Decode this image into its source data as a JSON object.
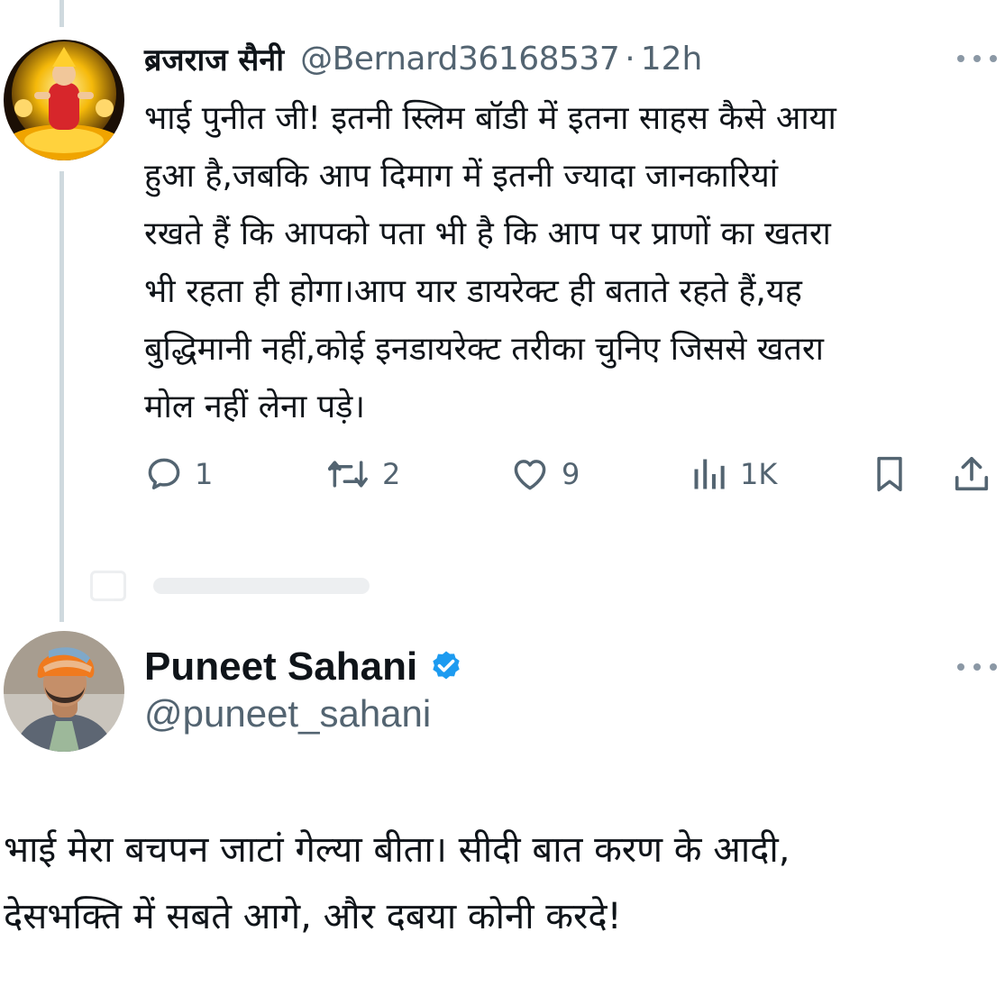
{
  "reply": {
    "display_name": "ब्रजराज सैनी",
    "handle": "@Bernard36168537",
    "separator": "·",
    "time": "12h",
    "text": "भाई पुनीत जी! इतनी स्लिम बॉडी में इतना साहस कैसे आया\nहुआ है,जबकि आप दिमाग में इतनी ज्यादा जानकारियां\nरखते हैं कि आपको पता भी है कि आप पर प्राणों का खतरा\nभी रहता ही होगा।आप यार डायरेक्ट ही बताते रहते हैं,यह\nबुद्धिमानी नहीं,कोई इनडायरेक्ट तरीका चुनिए जिससे खतरा\nमोल नहीं लेना पड़े।",
    "actions": {
      "replies": "1",
      "reposts": "2",
      "likes": "9",
      "views": "1K"
    },
    "avatar_icon": "goddess-avatar"
  },
  "main_post": {
    "display_name": "Puneet Sahani",
    "verified": true,
    "verified_color": "#1d9bf0",
    "handle": "@puneet_sahani",
    "text": "भाई मेरा बचपन जाटां गेल्या बीता। सीदी बात करण के आदी,\nदेसभक्ति में सबते आगे, और दबया कोनी करदे!",
    "avatar_icon": "turban-man-avatar"
  },
  "icons": {
    "reply": "speech-bubble-icon",
    "repost": "repost-arrows-icon",
    "like": "heart-icon",
    "views": "bar-chart-icon",
    "bookmark": "bookmark-icon",
    "share": "share-upload-icon",
    "more": "more-dots-icon"
  },
  "colors": {
    "text_primary": "#0f1419",
    "text_secondary": "#536471",
    "thread_line": "#cfd9de",
    "verified_blue": "#1d9bf0"
  }
}
